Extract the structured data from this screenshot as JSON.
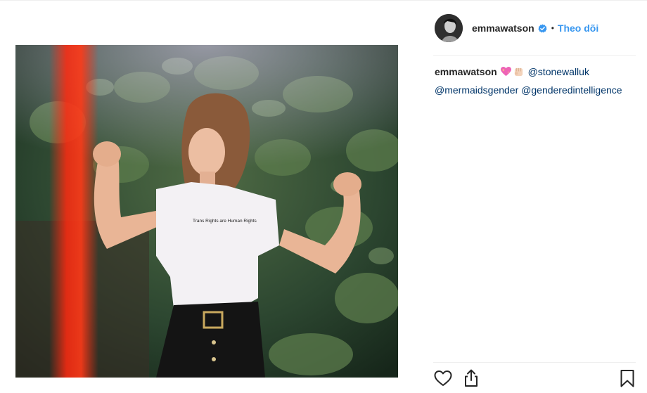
{
  "post": {
    "username": "emmawatson",
    "dot": "•",
    "follow_label": "Theo dõi",
    "photo_shirt_text": "Trans Rights are Human Rights"
  },
  "caption": {
    "username": "emmawatson",
    "mentions": [
      "@stonewalluk",
      "@mermaidsgender",
      "@genderedintelligence"
    ],
    "emojis": [
      "sparkling-heart-icon",
      "raised-fist-icon"
    ]
  },
  "actions": {
    "icons": [
      "heart-icon",
      "share-icon",
      "bookmark-icon"
    ]
  },
  "colors": {
    "accent": "#3897f0",
    "mention": "#003569",
    "text": "#262626",
    "divider": "#efefef"
  }
}
